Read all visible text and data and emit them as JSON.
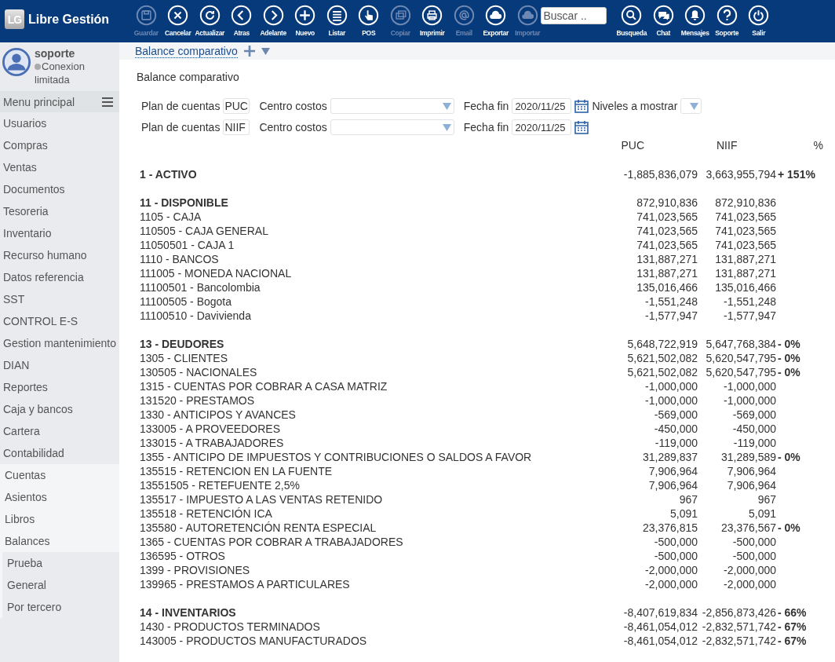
{
  "app": {
    "logo_mark": "LG",
    "name": "Libre Gestión"
  },
  "toolbar": [
    {
      "label": "Guardar",
      "kind": "save",
      "disabled": true
    },
    {
      "label": "Cancelar",
      "kind": "close",
      "disabled": false
    },
    {
      "label": "Actualizar",
      "kind": "refresh",
      "disabled": false
    },
    {
      "label": "Atras",
      "kind": "left",
      "disabled": false
    },
    {
      "label": "Adelante",
      "kind": "right",
      "disabled": false
    },
    {
      "label": "Nuevo",
      "kind": "plus",
      "disabled": false
    },
    {
      "label": "Listar",
      "kind": "list",
      "disabled": false
    },
    {
      "label": "POS",
      "kind": "hand",
      "disabled": false
    },
    {
      "label": "Copiar",
      "kind": "copy",
      "disabled": true
    },
    {
      "label": "Imprimir",
      "kind": "print",
      "disabled": false
    },
    {
      "label": "Email",
      "kind": "at",
      "disabled": true
    },
    {
      "label": "Exportar",
      "kind": "download",
      "disabled": false
    },
    {
      "label": "Importar",
      "kind": "upload",
      "disabled": true
    }
  ],
  "search": {
    "placeholder": "Buscar .."
  },
  "toolbar_right": [
    {
      "label": "Busqueda",
      "kind": "search"
    },
    {
      "label": "Chat",
      "kind": "chat"
    },
    {
      "label": "Mensajes",
      "kind": "bell"
    },
    {
      "label": "Soporte",
      "kind": "help"
    },
    {
      "label": "Salir",
      "kind": "power"
    }
  ],
  "user": {
    "name": "soporte",
    "status": "Conexion limitada"
  },
  "sidebar": {
    "title": "Menu principal",
    "items": [
      {
        "label": "Usuarios"
      },
      {
        "label": "Compras"
      },
      {
        "label": "Ventas"
      },
      {
        "label": "Documentos"
      },
      {
        "label": "Tesoreria"
      },
      {
        "label": "Inventario"
      },
      {
        "label": "Recurso humano"
      },
      {
        "label": "Datos referencia"
      },
      {
        "label": "SST"
      },
      {
        "label": "CONTROL E-S"
      },
      {
        "label": "Gestion mantenimiento"
      },
      {
        "label": "DIAN"
      },
      {
        "label": "Reportes"
      },
      {
        "label": "Caja y bancos"
      },
      {
        "label": "Cartera"
      },
      {
        "label": "Contabilidad",
        "children": [
          {
            "label": "Cuentas"
          },
          {
            "label": "Asientos"
          },
          {
            "label": "Libros"
          },
          {
            "label": "Balances",
            "children": [
              {
                "label": "Prueba"
              },
              {
                "label": "General"
              },
              {
                "label": "Por tercero"
              }
            ]
          }
        ]
      }
    ]
  },
  "tab": {
    "label": "Balance comparativo"
  },
  "page_title": "Balance comparativo",
  "filters": [
    {
      "plan_label": "Plan de cuentas",
      "plan": "PUC",
      "centro_label": "Centro costos",
      "fecha_label": "Fecha fin",
      "fecha": "2020/11/25",
      "niveles_label": "Niveles a mostrar"
    },
    {
      "plan_label": "Plan de cuentas",
      "plan": "NIIF",
      "centro_label": "Centro costos",
      "fecha_label": "Fecha fin",
      "fecha": "2020/11/25"
    }
  ],
  "table": {
    "columns": [
      "PUC",
      "NIIF",
      "%"
    ],
    "sections": [
      {
        "rows": [
          {
            "kind": "group",
            "account": "1 - ACTIVO",
            "puc": "-1,885,836,079",
            "niif": "3,663,955,794",
            "pct": "+ 151%"
          }
        ]
      },
      {
        "rows": [
          {
            "kind": "group",
            "account": "11 - DISPONIBLE",
            "puc": "872,910,836",
            "niif": "872,910,836"
          },
          {
            "kind": "line",
            "account": "1105 - CAJA",
            "puc": "741,023,565",
            "niif": "741,023,565"
          },
          {
            "kind": "line",
            "account": "110505 - CAJA GENERAL",
            "puc": "741,023,565",
            "niif": "741,023,565"
          },
          {
            "kind": "line",
            "account": "11050501 - CAJA 1",
            "puc": "741,023,565",
            "niif": "741,023,565"
          },
          {
            "kind": "line",
            "account": "1110 - BANCOS",
            "puc": "131,887,271",
            "niif": "131,887,271"
          },
          {
            "kind": "line",
            "account": "111005 - MONEDA NACIONAL",
            "puc": "131,887,271",
            "niif": "131,887,271"
          },
          {
            "kind": "line",
            "account": "11100501 - Bancolombia",
            "puc": "135,016,466",
            "niif": "135,016,466"
          },
          {
            "kind": "line",
            "account": "11100505 - Bogota",
            "puc": "-1,551,248",
            "niif": "-1,551,248"
          },
          {
            "kind": "line",
            "account": "11100510 - Davivienda",
            "puc": "-1,577,947",
            "niif": "-1,577,947"
          }
        ]
      },
      {
        "rows": [
          {
            "kind": "group",
            "account": "13 - DEUDORES",
            "puc": "5,648,722,919",
            "niif": "5,647,768,384",
            "pct": "- 0%"
          },
          {
            "kind": "line",
            "account": "1305 - CLIENTES",
            "puc": "5,621,502,082",
            "niif": "5,620,547,795",
            "pct": "- 0%"
          },
          {
            "kind": "line",
            "account": "130505 - NACIONALES",
            "puc": "5,621,502,082",
            "niif": "5,620,547,795",
            "pct": "- 0%"
          },
          {
            "kind": "line",
            "account": "1315 - CUENTAS POR COBRAR A CASA MATRIZ",
            "puc": "-1,000,000",
            "niif": "-1,000,000"
          },
          {
            "kind": "line",
            "account": "131520 - PRESTAMOS",
            "puc": "-1,000,000",
            "niif": "-1,000,000"
          },
          {
            "kind": "line",
            "account": "1330 - ANTICIPOS Y AVANCES",
            "puc": "-569,000",
            "niif": "-569,000"
          },
          {
            "kind": "line",
            "account": "133005 - A PROVEEDORES",
            "puc": "-450,000",
            "niif": "-450,000"
          },
          {
            "kind": "line",
            "account": "133015 - A TRABAJADORES",
            "puc": "-119,000",
            "niif": "-119,000"
          },
          {
            "kind": "line",
            "account": "1355 - ANTICIPO DE IMPUESTOS Y CONTRIBUCIONES O SALDOS A FAVOR",
            "puc": "31,289,837",
            "niif": "31,289,589",
            "pct": "- 0%"
          },
          {
            "kind": "line",
            "account": "135515 - RETENCION EN LA FUENTE",
            "puc": "7,906,964",
            "niif": "7,906,964"
          },
          {
            "kind": "line",
            "account": "13551505 - RETEFUENTE 2,5%",
            "puc": "7,906,964",
            "niif": "7,906,964"
          },
          {
            "kind": "line",
            "account": "135517 - IMPUESTO A LAS VENTAS RETENIDO",
            "puc": "967",
            "niif": "967"
          },
          {
            "kind": "line",
            "account": "135518 - RETENCIÓN ICA",
            "puc": "5,091",
            "niif": "5,091"
          },
          {
            "kind": "line",
            "account": "135580 - AUTORETENCIÓN RENTA ESPECIAL",
            "puc": "23,376,815",
            "niif": "23,376,567",
            "pct": "- 0%"
          },
          {
            "kind": "line",
            "account": "1365 - CUENTAS POR COBRAR A TRABAJADORES",
            "puc": "-500,000",
            "niif": "-500,000"
          },
          {
            "kind": "line",
            "account": "136595 - OTROS",
            "puc": "-500,000",
            "niif": "-500,000"
          },
          {
            "kind": "line",
            "account": "1399 - PROVISIONES",
            "puc": "-2,000,000",
            "niif": "-2,000,000"
          },
          {
            "kind": "line",
            "account": "139965 - PRESTAMOS A PARTICULARES",
            "puc": "-2,000,000",
            "niif": "-2,000,000"
          }
        ]
      },
      {
        "rows": [
          {
            "kind": "group",
            "account": "14 - INVENTARIOS",
            "puc": "-8,407,619,834",
            "niif": "-2,856,873,426",
            "pct": "- 66%"
          },
          {
            "kind": "line",
            "account": "1430 - PRODUCTOS TERMINADOS",
            "puc": "-8,461,054,012",
            "niif": "-2,832,571,742",
            "pct": "- 67%"
          },
          {
            "kind": "line",
            "account": "143005 - PRODUCTOS MANUFACTURADOS",
            "puc": "-8,461,054,012",
            "niif": "-2,832,571,742",
            "pct": "- 67%"
          }
        ]
      }
    ]
  }
}
